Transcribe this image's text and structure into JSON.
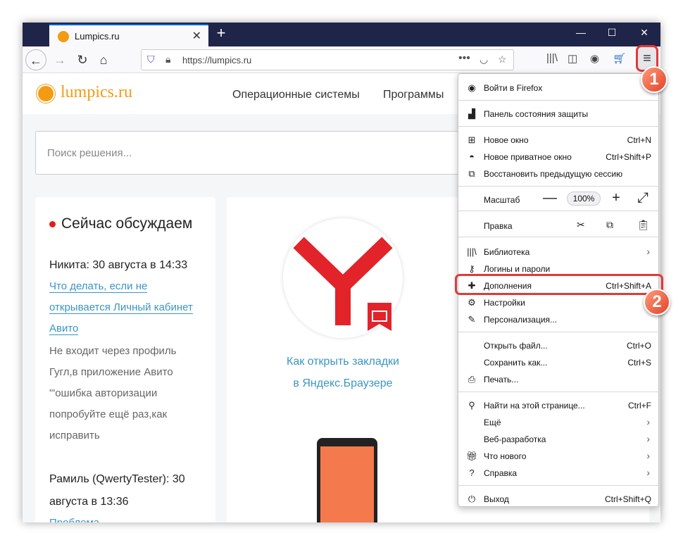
{
  "tab": {
    "title": "Lumpics.ru"
  },
  "window_controls": {
    "minimize": "—",
    "maximize": "☐",
    "close": "✕"
  },
  "toolbar": {
    "back": "←",
    "forward": "→",
    "reload": "↻",
    "home": "⌂",
    "url": "https://lumpics.ru",
    "menu": "≡"
  },
  "site": {
    "logo": "lumpics.ru",
    "nav": [
      "Операционные системы",
      "Программы"
    ],
    "search_placeholder": "Поиск решения...",
    "discuss": {
      "title": "Сейчас обсуждаем",
      "author1": "Никита: 30 августа в 14:33",
      "link1": [
        "Что делать, если не",
        "открывается Личный кабинет",
        "Авито"
      ],
      "comment1": [
        "Не входит через профиль",
        "Гугл,в приложение Авито",
        "\"'ошибка авторизации",
        "попробуйте ещё раз,как",
        "исправить"
      ],
      "author2": [
        "Рамиль (QwertyTester): 30",
        "августа в 13:36"
      ],
      "link2": "Проблема..."
    },
    "article": [
      "Как открыть закладки",
      "в Яндекс.Браузере"
    ]
  },
  "badges": {
    "one": "1",
    "two": "2"
  },
  "menu": {
    "signin": "Войти в Firefox",
    "protection": "Панель состояния защиты",
    "new_window": {
      "label": "Новое окно",
      "shortcut": "Ctrl+N"
    },
    "private_window": {
      "label": "Новое приватное окно",
      "shortcut": "Ctrl+Shift+P"
    },
    "restore": "Восстановить предыдущую сессию",
    "zoom": {
      "label": "Масштаб",
      "minus": "—",
      "value": "100%",
      "plus": "+",
      "fullscreen": "⤢"
    },
    "edit": {
      "label": "Правка"
    },
    "library": "Библиотека",
    "logins": "Логины и пароли",
    "addons": {
      "label": "Дополнения",
      "shortcut": "Ctrl+Shift+A"
    },
    "settings": "Настройки",
    "customize": "Персонализация...",
    "open_file": {
      "label": "Открыть файл...",
      "shortcut": "Ctrl+O"
    },
    "save_as": {
      "label": "Сохранить как...",
      "shortcut": "Ctrl+S"
    },
    "print": "Печать...",
    "find": {
      "label": "Найти на этой странице...",
      "shortcut": "Ctrl+F"
    },
    "more": "Ещё",
    "web_dev": "Веб-разработка",
    "whats_new": "Что нового",
    "help": "Справка",
    "exit": {
      "label": "Выход",
      "shortcut": "Ctrl+Shift+Q"
    }
  },
  "colors": {
    "accent": "#f39c12",
    "highlight": "#e03a3a",
    "link": "#3a95c4",
    "tabbar": "#1f2449"
  }
}
